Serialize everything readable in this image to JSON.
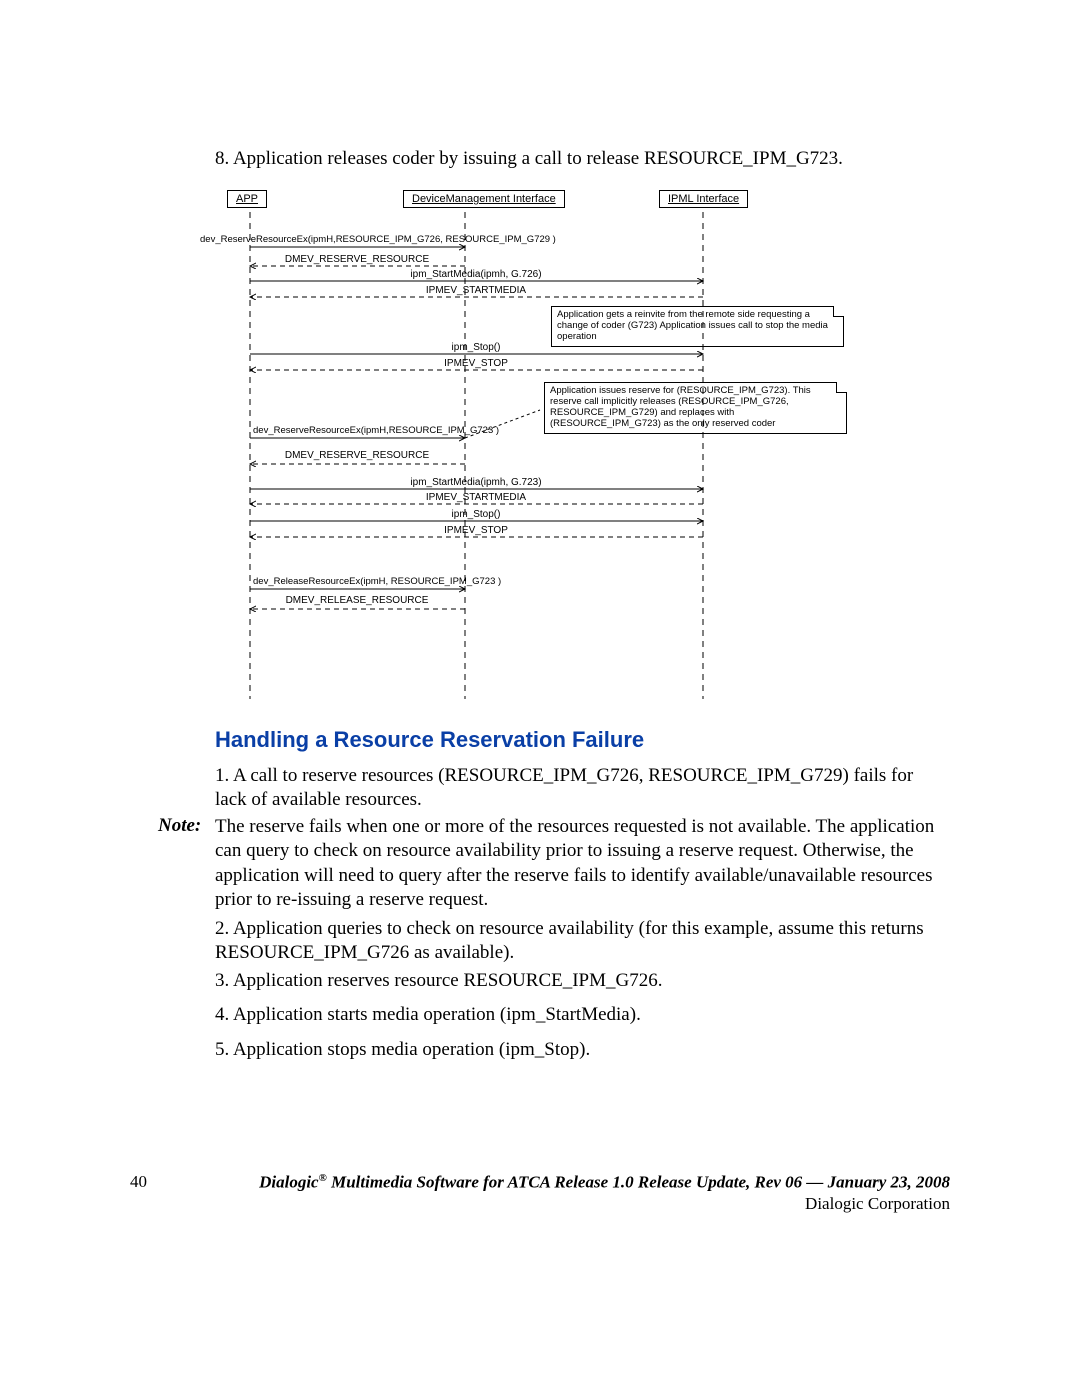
{
  "step8": "8. Application releases coder by issuing a call to release RESOURCE_IPM_G723.",
  "diagram": {
    "lifelines": {
      "app": "APP",
      "dmi": "DeviceManagement Interface",
      "ipml": "IPML Interface"
    },
    "msgs": {
      "r1_call": "dev_ReserveResourceEx(ipmH,RESOURCE_IPM_G726, RESOURCE_IPM_G729 )",
      "r1_ev": "DMEV_RESERVE_RESOURCE",
      "sm1": "ipm_StartMedia(ipmh, G.726)",
      "sm1_ev": "IPMEV_STARTMEDIA",
      "stop1": "ipm_Stop()",
      "stop1_ev": "IPMEV_STOP",
      "r2_call": "dev_ReserveResourceEx(ipmH,RESOURCE_IPM_G723 )",
      "r2_ev": "DMEV_RESERVE_RESOURCE",
      "sm2": "ipm_StartMedia(ipmh, G.723)",
      "sm2_ev": "IPMEV_STARTMEDIA",
      "stop2": "ipm_Stop()",
      "stop2_ev": "IPMEV_STOP",
      "rel_call": "dev_ReleaseResourceEx(ipmH, RESOURCE_IPM_G723 )",
      "rel_ev": "DMEV_RELEASE_RESOURCE"
    },
    "notes": {
      "n1": "Application gets a reinvite from the remote side requesting a change of coder (G723) Application issues call to stop the media operation",
      "n2": "Application issues reserve for (RESOURCE_IPM_G723). This reserve call implicitly releases  (RESOURCE_IPM_G726, RESOURCE_IPM_G729) and replaces with  (RESOURCE_IPM_G723) as the only reserved coder"
    }
  },
  "heading": "Handling a Resource Reservation Failure",
  "failure": {
    "p1": "1. A call to reserve resources (RESOURCE_IPM_G726, RESOURCE_IPM_G729) fails for lack of available resources.",
    "note_label": "Note:",
    "note": "The reserve fails when one or more of the resources requested is not available. The application can query to check on resource availability prior to issuing a reserve request. Otherwise, the application will need to query after the reserve fails to identify available/unavailable resources prior to re-issuing a reserve request.",
    "p2": "2. Application queries to check on resource availability (for this example, assume this returns RESOURCE_IPM_G726 as available).",
    "p3": "3. Application reserves resource RESOURCE_IPM_G726.",
    "p4": "4. Application starts media operation (ipm_StartMedia).",
    "p5": "5. Application stops media operation (ipm_Stop)."
  },
  "footer": {
    "page": "40",
    "product": "Dialogic",
    "reg": "®",
    "rest": " Multimedia Software for ATCA Release 1.0 Release Update, Rev 06  —  January 23, 2008",
    "corp": "Dialogic Corporation"
  }
}
